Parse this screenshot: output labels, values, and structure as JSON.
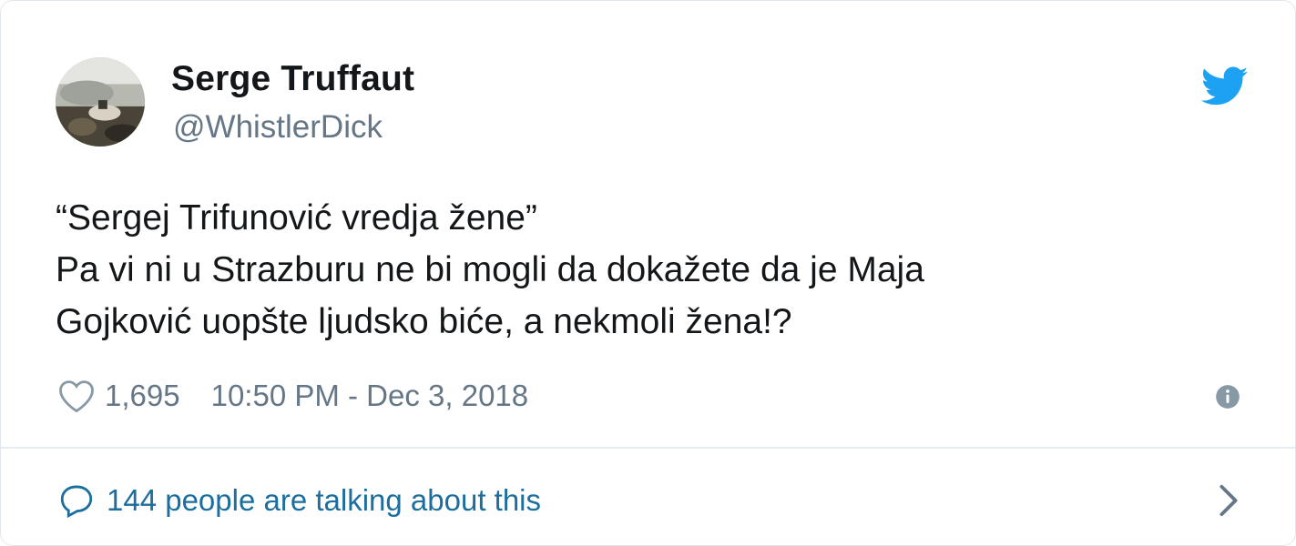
{
  "author": {
    "display_name": "Serge Truffaut",
    "handle": "@WhistlerDick"
  },
  "tweet": {
    "lines": [
      "“Sergej Trifunović vredja žene”",
      "Pa vi ni u Strazburu ne bi mogli da dokažete da je Maja",
      "Gojković uopšte ljudsko biće, a nekmoli žena!?"
    ]
  },
  "meta": {
    "like_count": "1,695",
    "timestamp": "10:50 PM - Dec 3, 2018"
  },
  "footer": {
    "talking_text": "144 people are talking about this"
  },
  "icons": {
    "brand": "twitter-bird-icon",
    "like": "heart-icon",
    "info": "info-icon",
    "reply": "speech-bubble-icon",
    "more": "chevron-right-icon"
  },
  "colors": {
    "twitter_blue": "#1da1f2",
    "link_blue": "#1b6e9e",
    "text": "#14171a",
    "secondary": "#657786"
  }
}
